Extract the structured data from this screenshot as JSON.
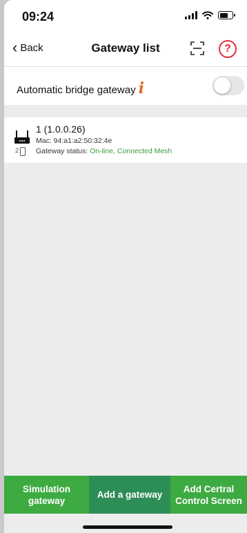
{
  "status_bar": {
    "time": "09:24",
    "icons": [
      "cellular-signal-icon",
      "wifi-icon",
      "battery-icon"
    ]
  },
  "nav": {
    "back_label": "Back",
    "title": "Gateway list",
    "right_icons": [
      "scan-icon",
      "help-icon"
    ]
  },
  "setting": {
    "label": "Automatic bridge gateway",
    "info_icon": "info-icon",
    "toggle_on": false
  },
  "gateways": [
    {
      "name": "1 (1.0.0.26)",
      "mac": "Mac: 94:a1:a2:50:32:4e",
      "status_prefix": "Gateway status: ",
      "status_value": "On-line, Connected Mesh",
      "device_count": "2",
      "icon": "router-icon"
    }
  ],
  "bottom_buttons": {
    "simulation": "Simulation gateway",
    "add": "Add a gateway",
    "add_central": "Add Certral Control Screen"
  },
  "colors": {
    "primary_green": "#3eaa42",
    "dark_green": "#2d8d56",
    "status_green": "#3a9a3e",
    "help_red": "#e0303b",
    "info_orange": "#e46b1f"
  }
}
